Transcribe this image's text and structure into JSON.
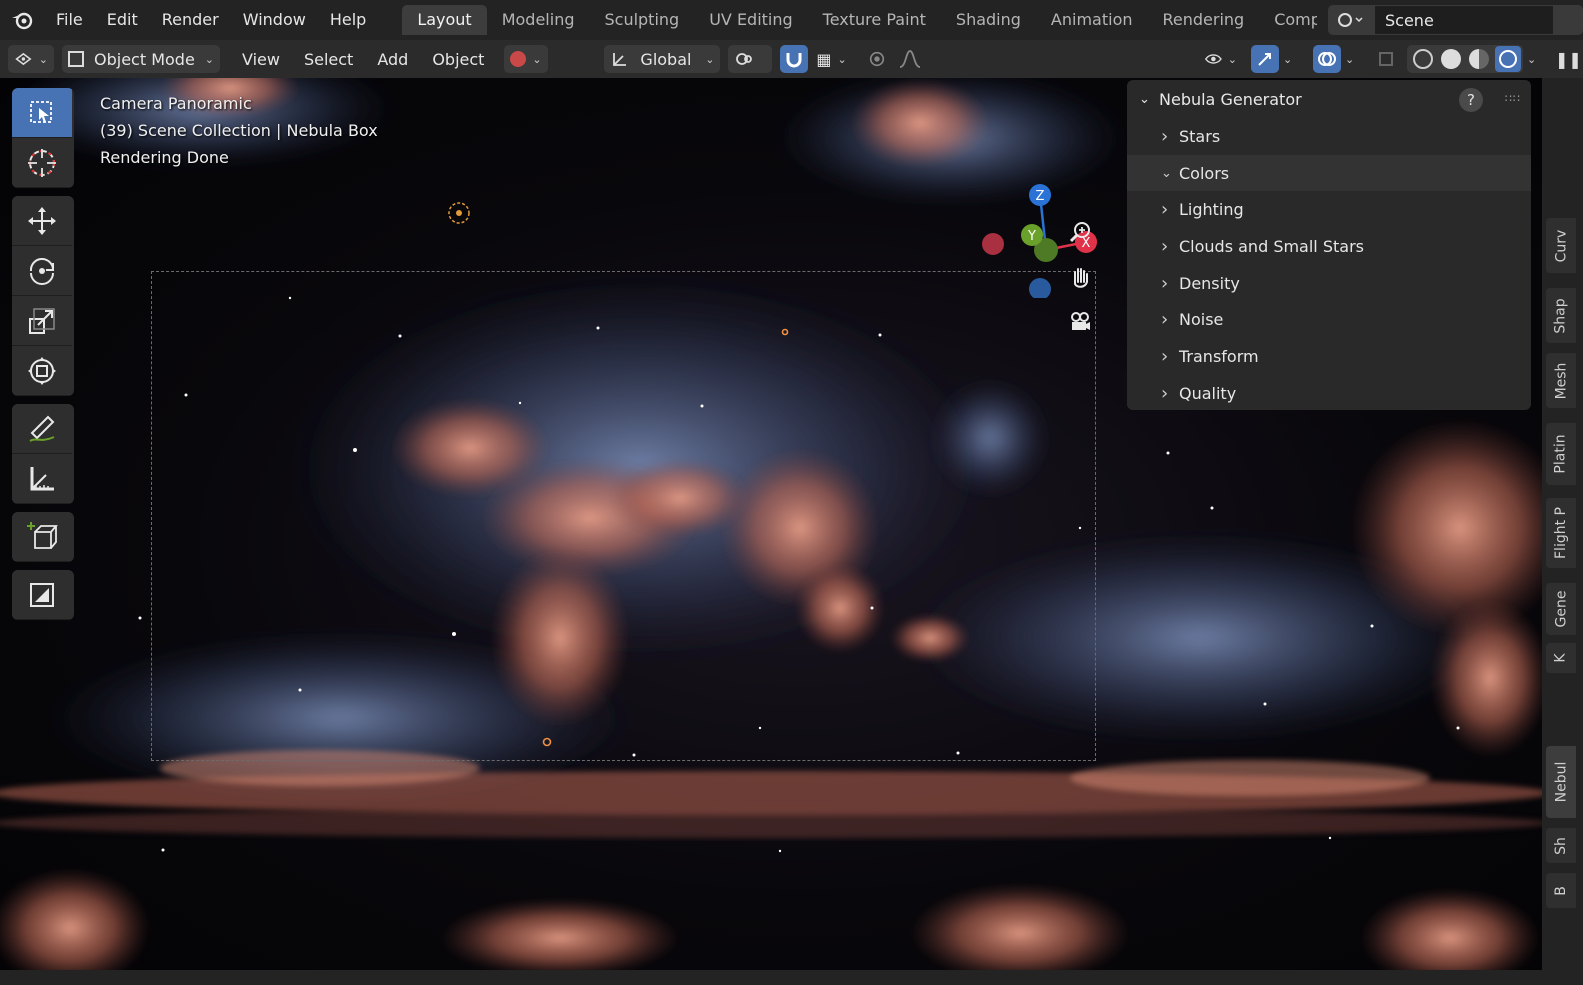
{
  "menu": [
    "File",
    "Edit",
    "Render",
    "Window",
    "Help"
  ],
  "workspaces": [
    "Layout",
    "Modeling",
    "Sculpting",
    "UV Editing",
    "Texture Paint",
    "Shading",
    "Animation",
    "Rendering",
    "Compo"
  ],
  "active_workspace": "Layout",
  "scene_name": "Scene",
  "header": {
    "mode": "Object Mode",
    "menus": [
      "View",
      "Select",
      "Add",
      "Object"
    ],
    "orientation": "Global"
  },
  "viewport_info": {
    "line1": "Camera Panoramic",
    "line2": "(39) Scene Collection | Nebula Box",
    "line3": "Rendering Done"
  },
  "gizmo": {
    "z": "Z",
    "y": "Y",
    "x": "X"
  },
  "npanel": {
    "title": "Nebula Generator",
    "help": "?",
    "sections": [
      {
        "label": "Stars",
        "open": false
      },
      {
        "label": "Colors",
        "open": true
      },
      {
        "label": "Lighting",
        "open": false
      },
      {
        "label": "Clouds and Small Stars",
        "open": false
      },
      {
        "label": "Density",
        "open": false
      },
      {
        "label": "Noise",
        "open": false
      },
      {
        "label": "Transform",
        "open": false
      },
      {
        "label": "Quality",
        "open": false
      }
    ]
  },
  "side_tabs": [
    "Curv",
    "Shap",
    "Mesh",
    "Platin",
    "Flight P",
    "Gene",
    "K",
    "Nebul",
    "Sh",
    "B"
  ],
  "active_side_tab": "Nebul",
  "colors": {
    "accent": "#4772b3",
    "nebula_red": "#c9735f",
    "nebula_blue": "#6f86b8",
    "axis_x": "#e0334a",
    "axis_y": "#6aa12a",
    "axis_z": "#2a72d6"
  }
}
